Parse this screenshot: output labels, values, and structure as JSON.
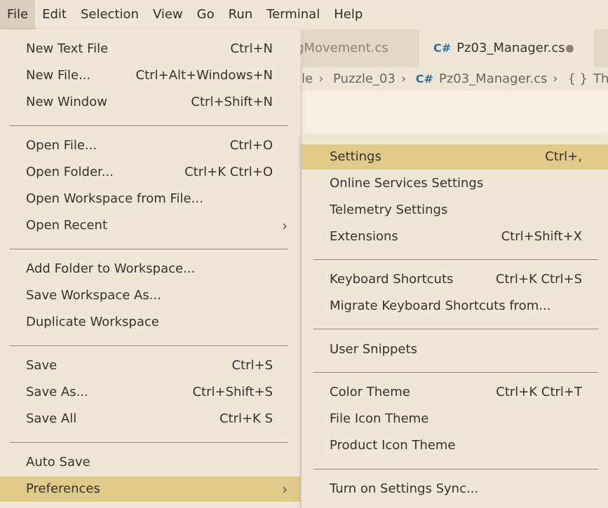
{
  "menubar": {
    "items": [
      "File",
      "Edit",
      "Selection",
      "View",
      "Go",
      "Run",
      "Terminal",
      "Help"
    ]
  },
  "tabs": [
    {
      "label": "gMovement.cs"
    },
    {
      "label": "Pz03_Manager.cs",
      "icon": "C#"
    }
  ],
  "breadcrumb": {
    "parts": [
      "le",
      "Puzzle_03",
      "Pz03_Manager.cs",
      "ThesisF"
    ],
    "csharp_icon": "C#",
    "braces_icon": "{ }"
  },
  "file_menu": {
    "groups": [
      [
        {
          "label": "New Text File",
          "key": "Ctrl+N"
        },
        {
          "label": "New File...",
          "key": "Ctrl+Alt+Windows+N"
        },
        {
          "label": "New Window",
          "key": "Ctrl+Shift+N"
        }
      ],
      [
        {
          "label": "Open File...",
          "key": "Ctrl+O"
        },
        {
          "label": "Open Folder...",
          "key": "Ctrl+K Ctrl+O"
        },
        {
          "label": "Open Workspace from File...",
          "key": ""
        },
        {
          "label": "Open Recent",
          "key": "",
          "submenu": true
        }
      ],
      [
        {
          "label": "Add Folder to Workspace...",
          "key": ""
        },
        {
          "label": "Save Workspace As...",
          "key": ""
        },
        {
          "label": "Duplicate Workspace",
          "key": ""
        }
      ],
      [
        {
          "label": "Save",
          "key": "Ctrl+S"
        },
        {
          "label": "Save As...",
          "key": "Ctrl+Shift+S"
        },
        {
          "label": "Save All",
          "key": "Ctrl+K S"
        }
      ],
      [
        {
          "label": "Auto Save",
          "key": ""
        },
        {
          "label": "Preferences",
          "key": "",
          "submenu": true,
          "highlight": true
        }
      ]
    ]
  },
  "pref_menu": {
    "groups": [
      [
        {
          "label": "Settings",
          "key": "Ctrl+,",
          "highlight": true
        },
        {
          "label": "Online Services Settings",
          "key": ""
        },
        {
          "label": "Telemetry Settings",
          "key": ""
        },
        {
          "label": "Extensions",
          "key": "Ctrl+Shift+X"
        }
      ],
      [
        {
          "label": "Keyboard Shortcuts",
          "key": "Ctrl+K Ctrl+S"
        },
        {
          "label": "Migrate Keyboard Shortcuts from...",
          "key": ""
        }
      ],
      [
        {
          "label": "User Snippets",
          "key": ""
        }
      ],
      [
        {
          "label": "Color Theme",
          "key": "Ctrl+K Ctrl+T"
        },
        {
          "label": "File Icon Theme",
          "key": ""
        },
        {
          "label": "Product Icon Theme",
          "key": ""
        }
      ],
      [
        {
          "label": "Turn on Settings Sync...",
          "key": ""
        }
      ]
    ]
  },
  "colors": {
    "background": "#efe7d6",
    "highlight": "#e0ca88",
    "active_menu": "#d8cfbc",
    "csharp": "#2c6f9c"
  }
}
